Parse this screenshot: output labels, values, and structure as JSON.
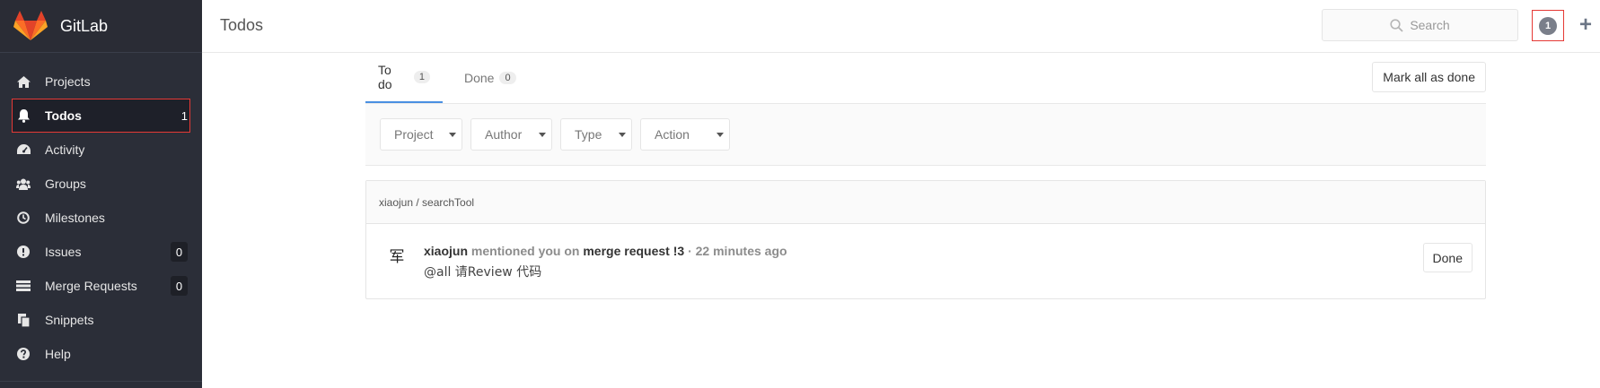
{
  "brand": {
    "name": "GitLab"
  },
  "sidebar": {
    "items": [
      {
        "label": "Projects",
        "icon": "home-icon"
      },
      {
        "label": "Todos",
        "icon": "bell-icon",
        "count": "1"
      },
      {
        "label": "Activity",
        "icon": "dashboard-icon"
      },
      {
        "label": "Groups",
        "icon": "users-icon"
      },
      {
        "label": "Milestones",
        "icon": "clock-icon"
      },
      {
        "label": "Issues",
        "icon": "exclamation-circle-icon",
        "count": "0"
      },
      {
        "label": "Merge Requests",
        "icon": "list-icon",
        "count": "0"
      },
      {
        "label": "Snippets",
        "icon": "clipboard-icon"
      },
      {
        "label": "Help",
        "icon": "question-circle-icon"
      }
    ]
  },
  "header": {
    "title": "Todos",
    "search_placeholder": "Search",
    "todos_count": "1",
    "plus": "+"
  },
  "tabs": [
    {
      "label": "To do",
      "count": "1"
    },
    {
      "label": "Done",
      "count": "0"
    }
  ],
  "mark_all_label": "Mark all as done",
  "filters": [
    {
      "label": "Project"
    },
    {
      "label": "Author"
    },
    {
      "label": "Type"
    },
    {
      "label": "Action"
    }
  ],
  "todo_group": {
    "project_path": "xiaojun / searchTool",
    "todo": {
      "avatar_char": "军",
      "author": "xiaojun",
      "action_text": "mentioned you on",
      "target": "merge request !3",
      "separator": "·",
      "time": "22 minutes ago",
      "body": "@all 请Review 代码",
      "done_label": "Done"
    }
  },
  "colors": {
    "sidebar_bg": "#2b2e38",
    "active_outline": "#e53935",
    "tab_active": "#4a90e2"
  }
}
